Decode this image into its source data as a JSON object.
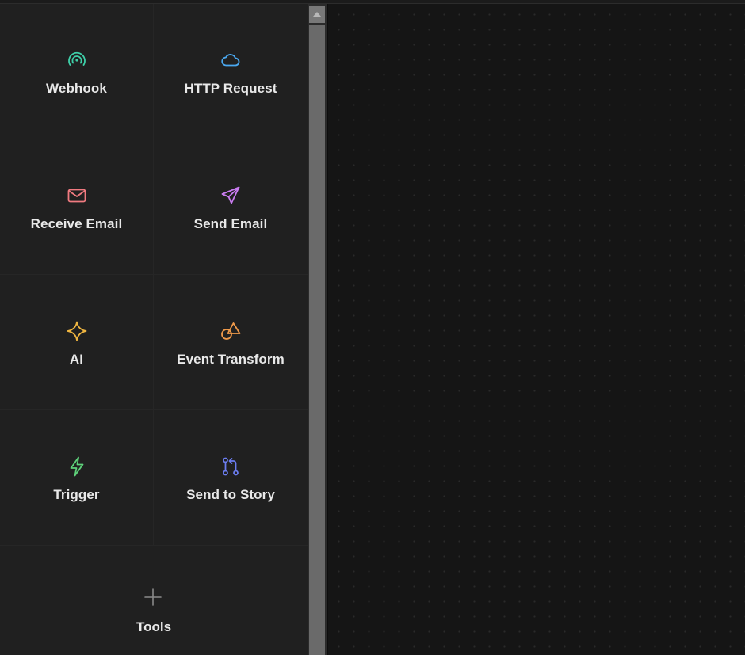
{
  "palette": {
    "items": [
      {
        "label": "Webhook",
        "icon": "webhook-icon",
        "color": "#3ecfa8"
      },
      {
        "label": "HTTP Request",
        "icon": "cloud-icon",
        "color": "#4aa8f0"
      },
      {
        "label": "Receive Email",
        "icon": "mail-icon",
        "color": "#f07a80"
      },
      {
        "label": "Send Email",
        "icon": "send-icon",
        "color": "#c97cf0"
      },
      {
        "label": "AI",
        "icon": "sparkle-icon",
        "color": "#f0b640"
      },
      {
        "label": "Event Transform",
        "icon": "shapes-icon",
        "color": "#f09a4a"
      },
      {
        "label": "Trigger",
        "icon": "lightning-icon",
        "color": "#5ed17a"
      },
      {
        "label": "Send to Story",
        "icon": "git-pull-request-icon",
        "color": "#6b7df0"
      }
    ],
    "tools": {
      "label": "Tools",
      "icon": "plus-icon",
      "color": "#8a8a8a"
    }
  },
  "scrollbar": {
    "thumb_color": "#6a6a6a"
  },
  "canvas": {
    "background": "#151515",
    "dot_color": "#2a2a2a"
  }
}
